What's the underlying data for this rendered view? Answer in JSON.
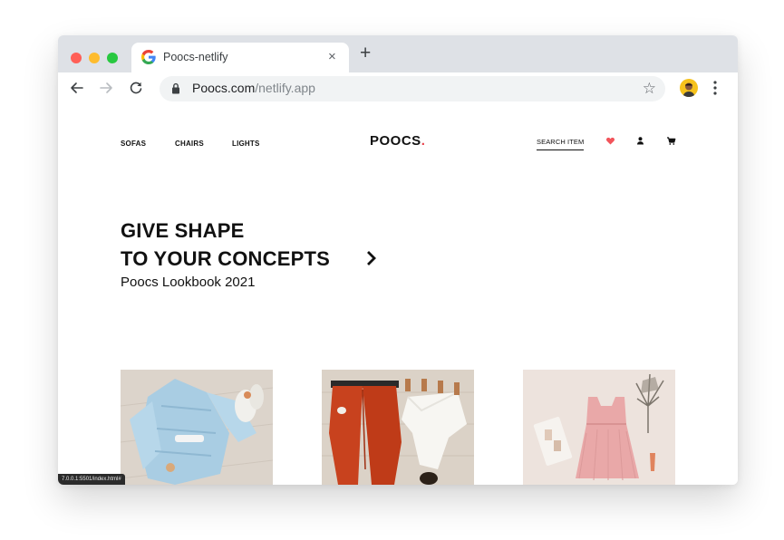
{
  "browser": {
    "tab_title": "Poocs-netlify",
    "tab_close": "×",
    "new_tab": "+",
    "url_host": "Poocs.com",
    "url_path": "/netlify.app",
    "bookmark_star": "☆",
    "status_url": "7.0.0.1:5501/index.html#"
  },
  "site": {
    "nav": [
      "SOFAS",
      "CHAIRS",
      "LIGHTS"
    ],
    "logo_text": "POOCS",
    "logo_dot": ".",
    "search_label": "SEARCH ITEM",
    "heart_color": "#f2545b",
    "accent": "#e8434d"
  },
  "hero": {
    "line1": "GIVE SHAPE",
    "line2": "TO YOUR CONCEPTS",
    "subtitle": "Poocs Lookbook 2021"
  },
  "products": [
    {
      "name": "blue-shirt-outfit",
      "bg": "#d9d1c8"
    },
    {
      "name": "orange-trousers-outfit",
      "bg": "#d8cfc4"
    },
    {
      "name": "pink-dress-outfit",
      "bg": "#ece2dc"
    }
  ]
}
